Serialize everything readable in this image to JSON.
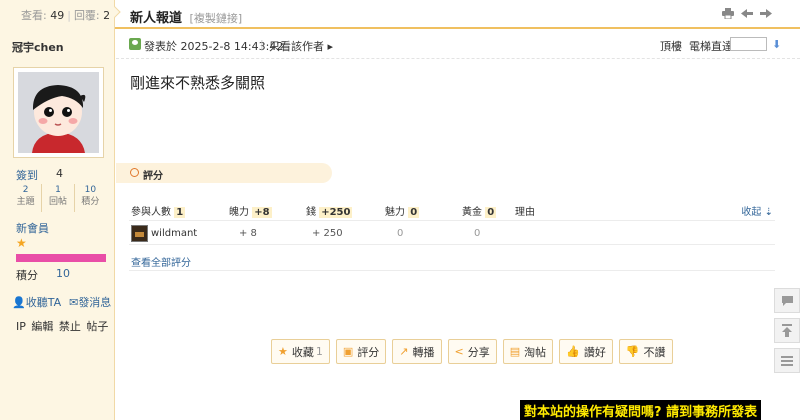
{
  "header": {
    "views_label": "查看:",
    "views": "49",
    "replies_label": "回覆:",
    "replies": "2",
    "title": "新人報道",
    "copy_link": "[複製鏈接]"
  },
  "user": {
    "name": "冠宇chen",
    "signin_label": "簽到",
    "signin_value": "4",
    "stats": [
      {
        "value": "2",
        "label": "主題"
      },
      {
        "value": "1",
        "label": "回帖"
      },
      {
        "value": "10",
        "label": "積分"
      }
    ],
    "group": "新會員",
    "level_progress_percent": 100,
    "credits_label": "積分",
    "credits_value": "10",
    "follow_label": "收聽TA",
    "message_label": "發消息",
    "admin_links": [
      "IP",
      "編輯",
      "禁止",
      "帖子"
    ]
  },
  "post": {
    "posted_at": "發表於 2025-2-8 14:43:42",
    "separator": "|",
    "author_only": "只看該作者",
    "floor": "頂樓",
    "goto_label": "電梯直達",
    "goto_value": "",
    "content": "剛進來不熟悉多關照"
  },
  "rating": {
    "title": "評分",
    "headers": {
      "participants_label": "參與人數",
      "participants": "1",
      "charm_label": "魄力",
      "charm": "+8",
      "money_label": "錢",
      "money": "+250",
      "appeal_label": "魅力",
      "appeal": "0",
      "gold_label": "黃金",
      "gold": "0",
      "reason_label": "理由",
      "collapse": "收起"
    },
    "rows": [
      {
        "user": "wildmant",
        "charm": "+ 8",
        "money": "+ 250",
        "appeal": "0",
        "gold": "0",
        "reason": ""
      }
    ],
    "view_all": "查看全部評分"
  },
  "buttons": [
    {
      "label": "收藏",
      "count": "1",
      "icon": "star-icon"
    },
    {
      "label": "評分",
      "count": "",
      "icon": "rate-icon"
    },
    {
      "label": "轉播",
      "count": "",
      "icon": "forward-icon"
    },
    {
      "label": "分享",
      "count": "",
      "icon": "share-icon"
    },
    {
      "label": "淘帖",
      "count": "",
      "icon": "collect-icon"
    },
    {
      "label": "讚好",
      "count": "",
      "icon": "thumbs-up-icon"
    },
    {
      "label": "不讚",
      "count": "",
      "icon": "thumbs-down-icon"
    }
  ],
  "banner": "對本站的操作有疑問嗎? 請到事務所發表",
  "colors": {
    "accent": "#f0c060",
    "link": "#336699",
    "sidebar_bg": "#fdf6e3",
    "level_bar": "#e94ea7"
  }
}
